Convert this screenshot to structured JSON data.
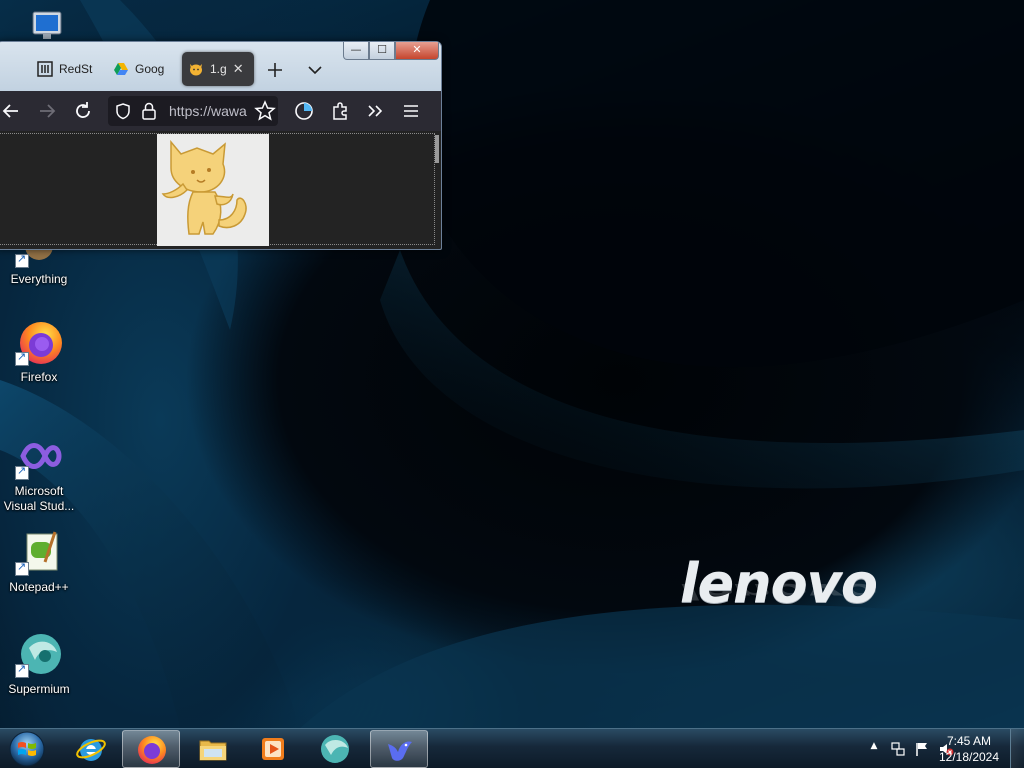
{
  "desktop": {
    "wallpaper_brand": "lenovo",
    "icons": [
      {
        "label": "Everything"
      },
      {
        "label": "Firefox"
      },
      {
        "label": "Microsoft Visual Stud..."
      },
      {
        "label": "Notepad++"
      },
      {
        "label": "Supermium"
      }
    ]
  },
  "browser": {
    "tabs": [
      {
        "label": "RedSt",
        "icon": "redstone-icon"
      },
      {
        "label": "Goog",
        "icon": "google-drive-icon"
      },
      {
        "label": "1.g",
        "icon": "cat-emoji-icon",
        "active": true
      }
    ],
    "url": "https://wawa",
    "window_controls": {
      "minimize": "—",
      "maximize": "☐",
      "close": "✕"
    },
    "content_image": "cat-drawing"
  },
  "taskbar": {
    "pinned": [
      {
        "name": "internet-explorer"
      },
      {
        "name": "firefox",
        "active": true
      },
      {
        "name": "file-explorer"
      },
      {
        "name": "media-player"
      },
      {
        "name": "supermium"
      },
      {
        "name": "bird-app",
        "active": true
      }
    ],
    "clock": {
      "time": "7:45 AM",
      "date": "12/18/2024"
    },
    "tray_expand": "▲"
  },
  "colors": {
    "taskbar": "#16283a",
    "browser_toolbar": "#2b2a33",
    "content_bg": "#232323",
    "close_button": "#c6452d"
  }
}
